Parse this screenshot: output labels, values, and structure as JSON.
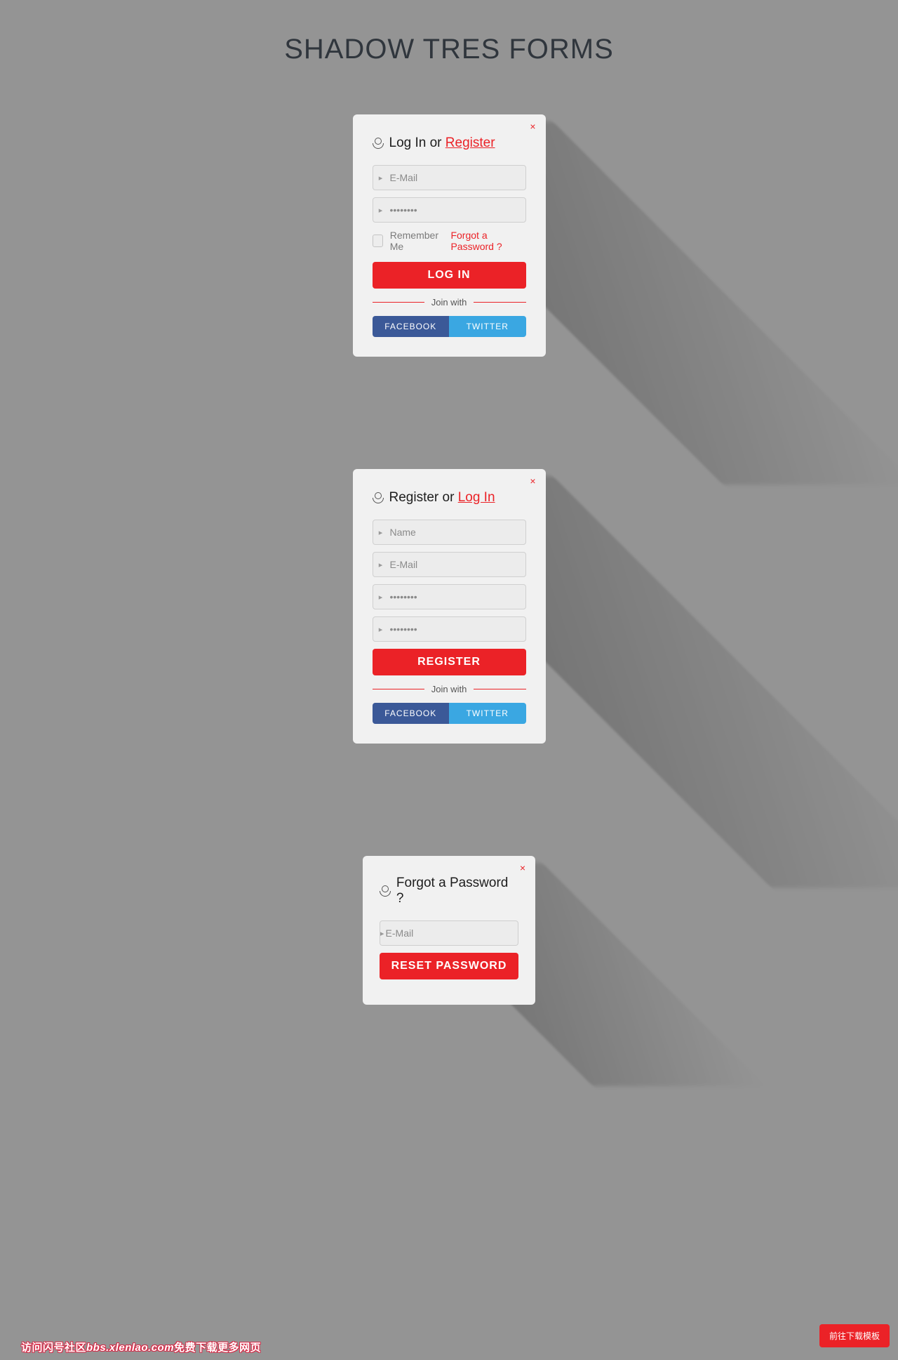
{
  "page_title": "SHADOW TRES FORMS",
  "login": {
    "title_prefix": "Log In or ",
    "title_accent": "Register",
    "email_placeholder": "E-Mail",
    "password_placeholder": "••••••••",
    "remember_label": "Remember Me",
    "forgot_label": "Forgot a Password ?",
    "submit_label": "LOG IN",
    "join_label": "Join with",
    "facebook_label": "FACEBOOK",
    "twitter_label": "TWITTER",
    "close": "×"
  },
  "register": {
    "title_prefix": "Register or ",
    "title_accent": "Log In",
    "name_placeholder": "Name",
    "email_placeholder": "E-Mail",
    "password_placeholder": "••••••••",
    "confirm_placeholder": "••••••••",
    "submit_label": "REGISTER",
    "join_label": "Join with",
    "facebook_label": "FACEBOOK",
    "twitter_label": "TWITTER",
    "close": "×"
  },
  "forgot": {
    "title": "Forgot a Password ?",
    "email_placeholder": "E-Mail",
    "submit_label": "RESET PASSWORD",
    "close": "×"
  },
  "footer": {
    "pill_label": "前往下载模板",
    "watermark_cn1": "访问闪号社区",
    "watermark_en": "bbs.xlenlao.com",
    "watermark_cn2": "免费下载更多网页"
  }
}
